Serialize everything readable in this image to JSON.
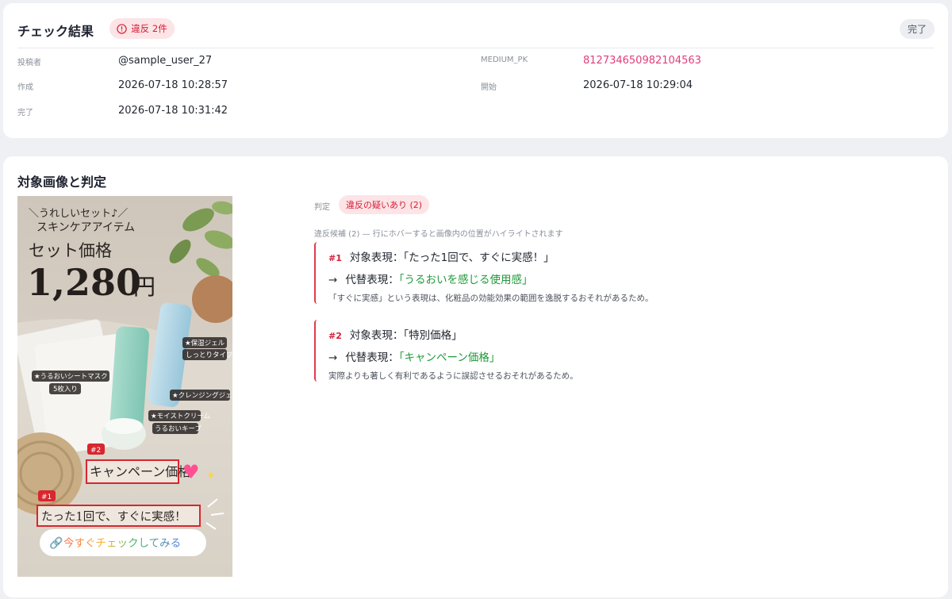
{
  "result": {
    "title": "チェック結果",
    "violation_badge": "違反 2件",
    "status": "完了",
    "fields": {
      "poster_label": "投稿者",
      "poster_value": "@sample_user_27",
      "medium_pk_label": "MEDIUM_PK",
      "medium_pk_value": "812734650982104563",
      "created_label": "作成",
      "created_value": "2026-07-18 10:28:57",
      "started_label": "開始",
      "started_value": "2026-07-18 10:29:04",
      "completed_label": "完了",
      "completed_value": "2026-07-18 10:31:42"
    }
  },
  "target": {
    "title": "対象画像と判定",
    "image": {
      "lines": {
        "tag": "＼うれしいセット♪／",
        "line1": "スキンケアアイテム",
        "line2": "セット価格",
        "price": "1,280",
        "yen": "円",
        "items": [
          "★保湿ジェル",
          "しっとりタイプ",
          "★うるおいシートマスク",
          "5枚入り",
          "★クレンジングジェル",
          "★モイストクリーム",
          "うるおいキープ"
        ],
        "highlight2": "キャンペーン価格",
        "highlight1": "たった1回で、すぐに実感！",
        "marker2": "#2",
        "marker1": "#1",
        "cta": "今すぐチェックしてみる"
      }
    },
    "judgement_label": "判定",
    "judgement_value": "違反の疑いあり (2)",
    "candidates_hint": "違反候補 (2) — 行にホバーすると画像内の位置がハイライトされます",
    "candidates": [
      {
        "num": "#1",
        "target_label": "対象表現：",
        "target_text": "「たった1回で、すぐに実感！」",
        "arrow": "→",
        "alt_label": "代替表現：",
        "alt_text": "「うるおいを感じる使用感」",
        "reason": "「すぐに実感」という表現は、化粧品の効能効果の範囲を逸脱するおそれがあるため。"
      },
      {
        "num": "#2",
        "target_label": "対象表現：",
        "target_text": "「特別価格」",
        "arrow": "→",
        "alt_label": "代替表現：",
        "alt_text": "「キャンペーン価格」",
        "reason": "実際よりも著しく有利であるように誤認させるおそれがあるため。"
      }
    ]
  },
  "colors": {
    "accent_red": "#d3203a",
    "pink_id": "#e23d7a",
    "green_alt": "#1f9a3a"
  }
}
